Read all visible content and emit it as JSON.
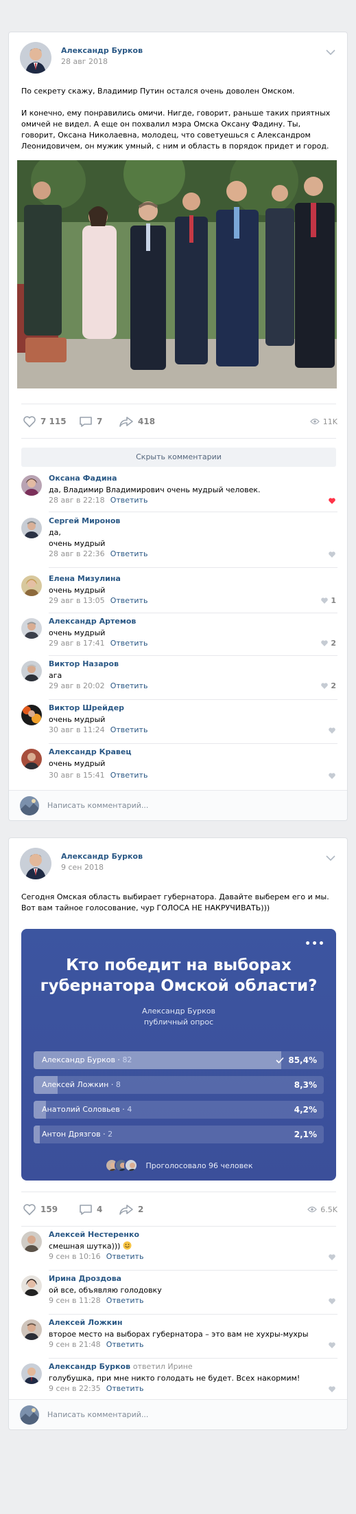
{
  "post1": {
    "author": "Александр Бурков",
    "date": "28 авг 2018",
    "paragraphs": [
      "По секрету скажу, Владимир Путин остался очень доволен Омском.",
      "И конечно, ему понравились омичи. Нигде, говорит, раньше таких приятных омичей не видел. А еще он похвалил мэра Омска Оксану Фадину. Ты, говорит, Оксана Николаевна, молодец, что советуешься с Александром Леонидовичем, он мужик умный, с ним и область в порядок придет и город."
    ],
    "likes": "7 115",
    "comments": "7",
    "shares": "418",
    "views": "11K",
    "collapse_label": "Скрыть комментарии",
    "comment_list": [
      {
        "name": "Оксана Фадина",
        "text": "да, Владимир Владимирович очень мудрый человек.",
        "date": "28 авг в 22:18",
        "reply": "Ответить",
        "likes": ""
      },
      {
        "name": "Сергей Миронов",
        "text_lines": [
          "да,",
          "очень мудрый"
        ],
        "date": "28 авг в 22:36",
        "reply": "Ответить",
        "likes": ""
      },
      {
        "name": "Елена Мизулина",
        "text": "очень мудрый",
        "date": "29 авг в 13:05",
        "reply": "Ответить",
        "likes": "1"
      },
      {
        "name": "Александр Артемов",
        "text": "очень мудрый",
        "date": "29 авг в 17:41",
        "reply": "Ответить",
        "likes": "2"
      },
      {
        "name": "Виктор Назаров",
        "text": "ага",
        "date": "29 авг в 20:02",
        "reply": "Ответить",
        "likes": "2"
      },
      {
        "name": "Виктор Шрейдер",
        "text": "очень мудрый",
        "date": "30 авг в 11:24",
        "reply": "Ответить",
        "likes": ""
      },
      {
        "name": "Александр Кравец",
        "text": "очень мудрый",
        "date": "30 авг в 15:41",
        "reply": "Ответить",
        "likes": ""
      }
    ],
    "reply_placeholder": "Написать комментарий..."
  },
  "post2": {
    "author": "Александр Бурков",
    "date": "9 сен 2018",
    "paragraphs": [
      "Сегодня Омская область выбирает губернатора. Давайте выберем его и мы. Вот вам тайное голосование, чур ГОЛОСА НЕ НАКРУЧИВАТЬ)))"
    ],
    "poll": {
      "title": "Кто победит на выборах губернатора Омской области?",
      "author": "Александр Бурков",
      "type": "публичный опрос",
      "options": [
        {
          "label": "Александр Бурков",
          "count": "82",
          "percent": "85,4%",
          "share": 85.4,
          "voted": true
        },
        {
          "label": "Алексей Ложкин",
          "count": "8",
          "percent": "8,3%",
          "share": 8.3,
          "voted": false
        },
        {
          "label": "Анатолий Соловьев",
          "count": "4",
          "percent": "4,2%",
          "share": 4.2,
          "voted": false
        },
        {
          "label": "Антон Дрязгов",
          "count": "2",
          "percent": "2,1%",
          "share": 2.1,
          "voted": false
        }
      ],
      "total": "Проголосовало 96 человек"
    },
    "likes": "159",
    "comments": "4",
    "shares": "2",
    "views": "6.5K",
    "comment_list": [
      {
        "name": "Алексей Нестеренко",
        "text": "смешная шутка)))",
        "date": "9 сен в 10:16",
        "reply": "Ответить"
      },
      {
        "name": "Ирина Дроздова",
        "text": "ой все, объявляю голодовку",
        "date": "9 сен в 11:28",
        "reply": "Ответить"
      },
      {
        "name": "Алексей Ложкин",
        "text": "второе место на выборах губернатора – это вам не хухры-мухры",
        "date": "9 сен в 21:48",
        "reply": "Ответить"
      },
      {
        "name": "Александр Бурков",
        "reply_to": "ответил Ирине",
        "text": "голубушка, при мне никто голодать не будет. Всех накормим!",
        "date": "9 сен в 22:35",
        "reply": "Ответить"
      }
    ],
    "reply_placeholder": "Написать комментарий..."
  },
  "colors": {
    "link": "#2a5885",
    "muted": "#939393",
    "like_active": "#ff3347",
    "poll_bg": "#3b4f9a"
  },
  "icons": [
    "chevron-down-icon",
    "heart-icon",
    "comment-icon",
    "share-icon",
    "eye-icon",
    "check-icon",
    "smile-emoji-icon"
  ]
}
